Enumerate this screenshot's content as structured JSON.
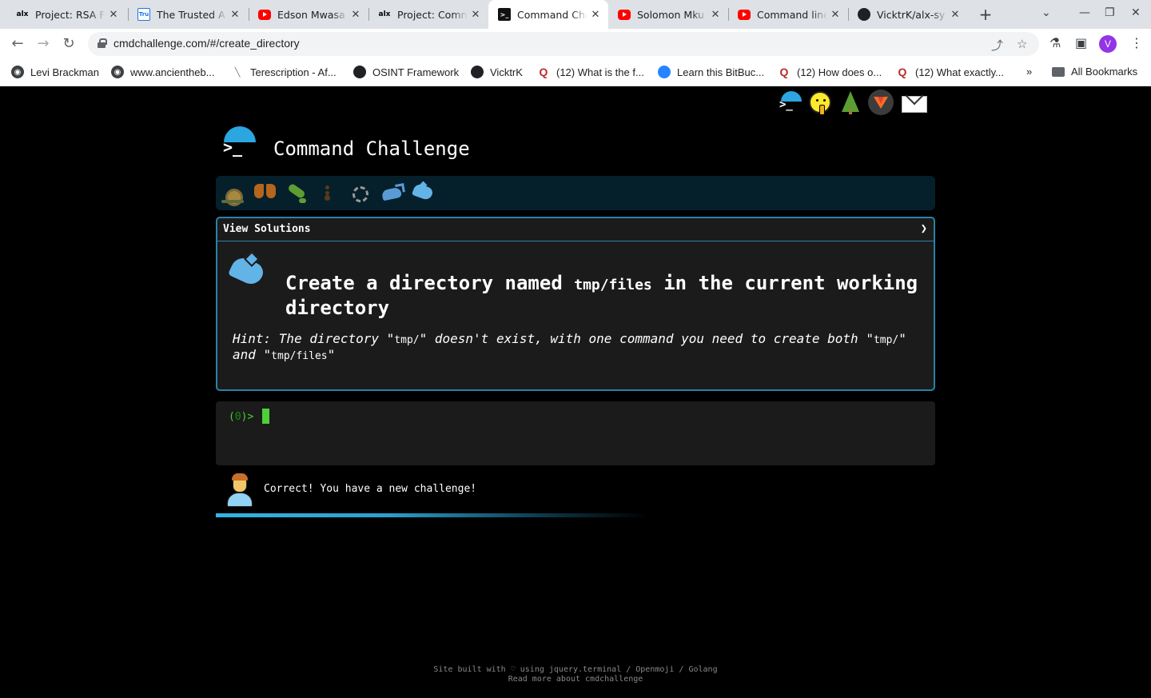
{
  "browser": {
    "tabs": [
      {
        "title": "Project: RSA F",
        "favicon": "alx-icon"
      },
      {
        "title": "The Trusted A",
        "favicon": "trusted-icon"
      },
      {
        "title": "Edson Mwasa",
        "favicon": "youtube-icon"
      },
      {
        "title": "Project: Comn",
        "favicon": "alx-icon"
      },
      {
        "title": "Command Cha",
        "favicon": "terminal-icon",
        "active": true
      },
      {
        "title": "Solomon Mku",
        "favicon": "youtube-icon"
      },
      {
        "title": "Command line",
        "favicon": "youtube-icon"
      },
      {
        "title": "VicktrK/alx-sy",
        "favicon": "github-icon"
      }
    ],
    "tab_favicon_text": {
      "alx": "alx",
      "trusted": "Tru",
      "terminal": ">_"
    },
    "url": "cmdchallenge.com/#/create_directory",
    "profile_initial": "V",
    "bookmarks": [
      {
        "label": "Levi Brackman",
        "icon": "globe-icon"
      },
      {
        "label": "www.ancientheb...",
        "icon": "globe-icon"
      },
      {
        "label": "Terescription - Af...",
        "icon": "pen-icon"
      },
      {
        "label": "OSINT Framework",
        "icon": "globe-icon"
      },
      {
        "label": "VicktrK",
        "icon": "github-icon"
      },
      {
        "label": "(12) What is the f...",
        "icon": "quora-icon"
      },
      {
        "label": "Learn this BitBuc...",
        "icon": "bitbucket-icon"
      },
      {
        "label": "(12) How does o...",
        "icon": "quora-icon"
      },
      {
        "label": "(12) What exactly...",
        "icon": "quora-icon"
      }
    ],
    "bookmarks_overflow": "»",
    "all_bookmarks_label": "All Bookmarks"
  },
  "page": {
    "brand_title": "Command Challenge",
    "brand_prompt": ">_",
    "level_icons": [
      "snail-icon",
      "butterfly-icon",
      "caterpillar-icon",
      "ant-icon",
      "gear-icon",
      "whale-icon",
      "dolphin-icon"
    ],
    "challenge": {
      "view_solutions_label": "View Solutions",
      "chevron": "❯",
      "title_pre": "Create a directory named ",
      "title_code": "tmp/files",
      "title_post": " in the current working directory",
      "hint_1": "Hint: The directory \"",
      "hint_code_1": "tmp/",
      "hint_2": "\" doesn't exist, with one command you need to create both \"",
      "hint_code_2": "tmp/",
      "hint_3": "\" and \"",
      "hint_code_3": "tmp/files",
      "hint_4": "\""
    },
    "terminal": {
      "prompt_open": "(",
      "prompt_count": "0",
      "prompt_close": ")> "
    },
    "feedback_message": "Correct! You have a new challenge!",
    "progress_fraction": 0.6,
    "footer": {
      "line1": "Site built with ♡ using jquery.terminal / Openmoji / Golang",
      "line2": "Read more about cmdchallenge"
    }
  },
  "colors": {
    "accent": "#2ba6e0",
    "prompt_green": "#4cd137",
    "box_border": "#2b82a8"
  }
}
